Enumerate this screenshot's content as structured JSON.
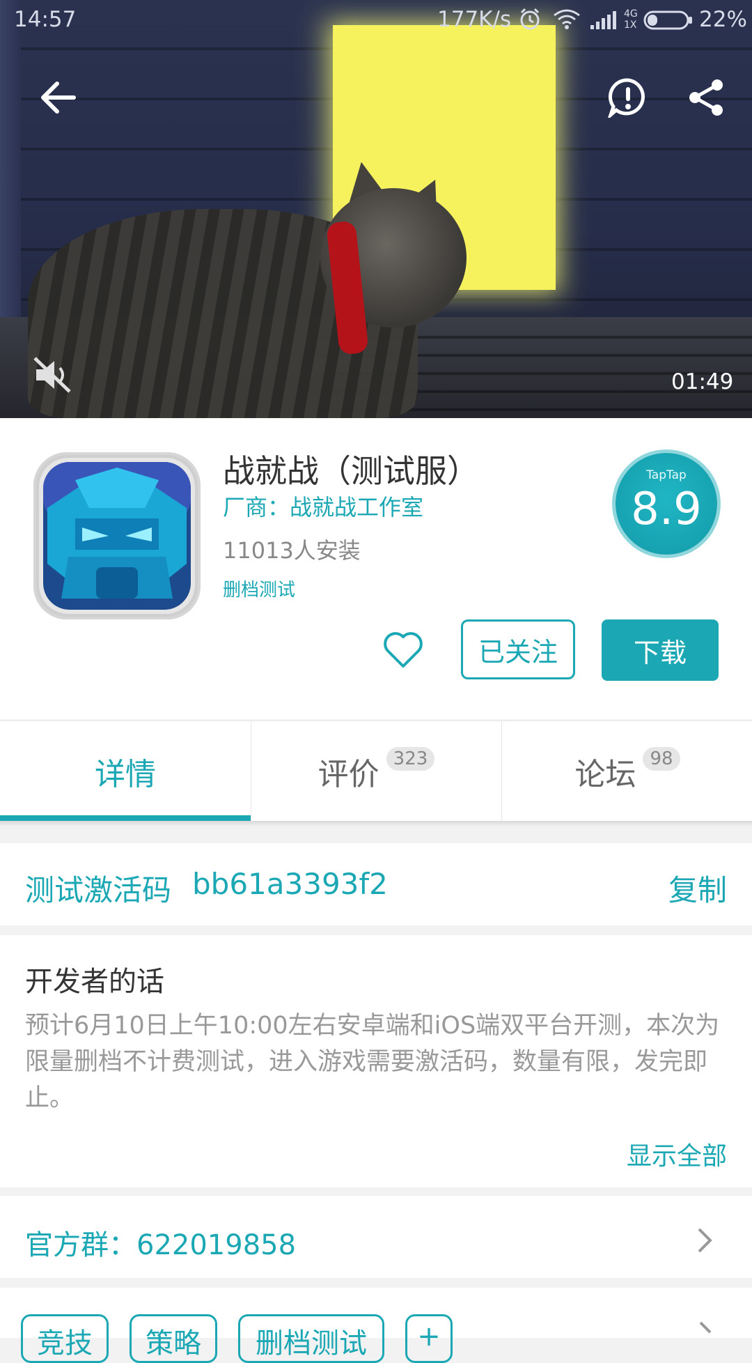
{
  "status_bar": {
    "time": "14:57",
    "net_speed": "177K/s",
    "net_type_top": "4G",
    "net_type_bottom": "1X",
    "battery": "22%"
  },
  "video": {
    "duration": "01:49",
    "icons": [
      "back-arrow-icon",
      "report-icon",
      "share-icon",
      "mute-icon"
    ]
  },
  "app": {
    "title": "战就战（测试服）",
    "vendor": "厂商：战就战工作室",
    "installs": "11013人安装",
    "tag": "删档测试",
    "score_brand": "TapTap",
    "score": "8.9",
    "follow_label": "已关注",
    "download_label": "下载"
  },
  "tabs": [
    {
      "label": "详情",
      "badge": ""
    },
    {
      "label": "评价",
      "badge": "323"
    },
    {
      "label": "论坛",
      "badge": "98"
    }
  ],
  "activation": {
    "label": "测试激活码",
    "code": "bb61a3393f2",
    "copy_label": "复制"
  },
  "developer": {
    "title": "开发者的话",
    "text": "预计6月10日上午10:00左右安卓端和iOS端双平台开测，本次为限量删档不计费测试，进入游戏需要激活码，数量有限，发完即止。",
    "show_all": "显示全部"
  },
  "group": {
    "text": "官方群：622019858"
  },
  "tags": [
    "竞技",
    "策略",
    "删档测试",
    "+"
  ],
  "colors": {
    "accent": "#1ba8b4",
    "door": "#f5f25e",
    "collar": "#b5131a"
  }
}
